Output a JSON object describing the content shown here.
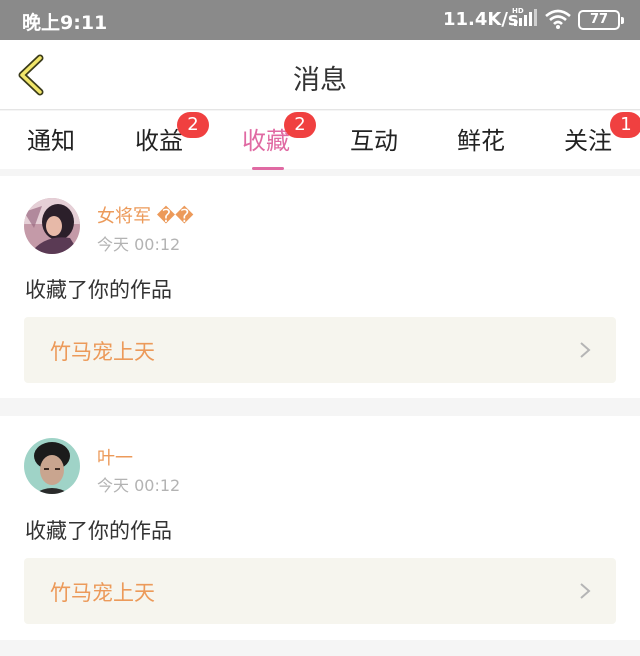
{
  "status_bar": {
    "time": "晚上9:11",
    "network_speed": "11.4K/s",
    "battery": "77"
  },
  "header": {
    "title": "消息"
  },
  "tabs": [
    {
      "label": "通知",
      "badge": ""
    },
    {
      "label": "收益",
      "badge": "2"
    },
    {
      "label": "收藏",
      "badge": "2",
      "active": true
    },
    {
      "label": "互动",
      "badge": ""
    },
    {
      "label": "鲜花",
      "badge": ""
    },
    {
      "label": "关注",
      "badge": "1"
    }
  ],
  "messages": [
    {
      "username": "女将军 ��",
      "time": "今天 00:12",
      "action": "收藏了你的作品",
      "work_title": "竹马宠上天"
    },
    {
      "username": "叶一",
      "time": "今天 00:12",
      "action": "收藏了你的作品",
      "work_title": "竹马宠上天"
    }
  ],
  "colors": {
    "accent": "#e06aa3",
    "username": "#ec9a5a",
    "badge": "#f04040",
    "work_bg": "#f6f5ee"
  }
}
